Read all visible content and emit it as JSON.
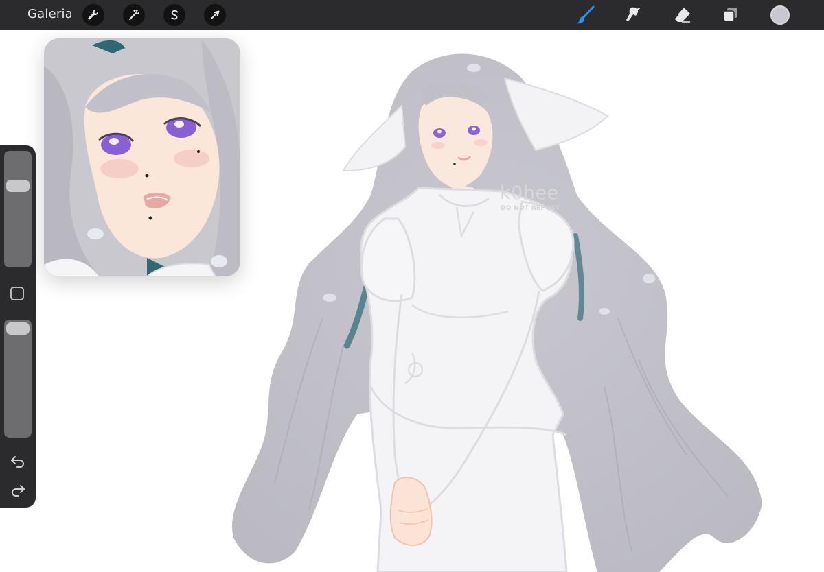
{
  "toolbar": {
    "gallery_label": "Galeria",
    "left_tools": [
      {
        "icon": "wrench-icon",
        "name": "actions"
      },
      {
        "icon": "magic-wand-icon",
        "name": "adjustments"
      },
      {
        "icon": "selection-s-icon",
        "name": "selection"
      },
      {
        "icon": "arrow-cursor-icon",
        "name": "transform"
      }
    ],
    "right_tools": [
      {
        "icon": "brush-icon",
        "name": "brush",
        "active": true
      },
      {
        "icon": "smudge-icon",
        "name": "smudge"
      },
      {
        "icon": "eraser-icon",
        "name": "eraser"
      },
      {
        "icon": "layers-icon",
        "name": "layers"
      }
    ],
    "active_color": "#c9c8d0",
    "accent_color": "#2f8fe6"
  },
  "canvas": {
    "watermark_main": "k0hee",
    "watermark_sub": "DO NOT REPOST"
  },
  "sidebar": {
    "brush_size": 0.0,
    "opacity": 0.0,
    "undo_icon": "undo-arrow-icon",
    "redo_icon": "redo-arrow-icon",
    "modify_icon": "square-modify-icon"
  },
  "colors": {
    "toolbar_bg": "#2b2b2d",
    "hair": "#c6c5cc",
    "hair_teal": "#3c6f7c",
    "eye": "#8d62d6",
    "skin": "#fbe6da",
    "outline": "#dcdce2"
  }
}
